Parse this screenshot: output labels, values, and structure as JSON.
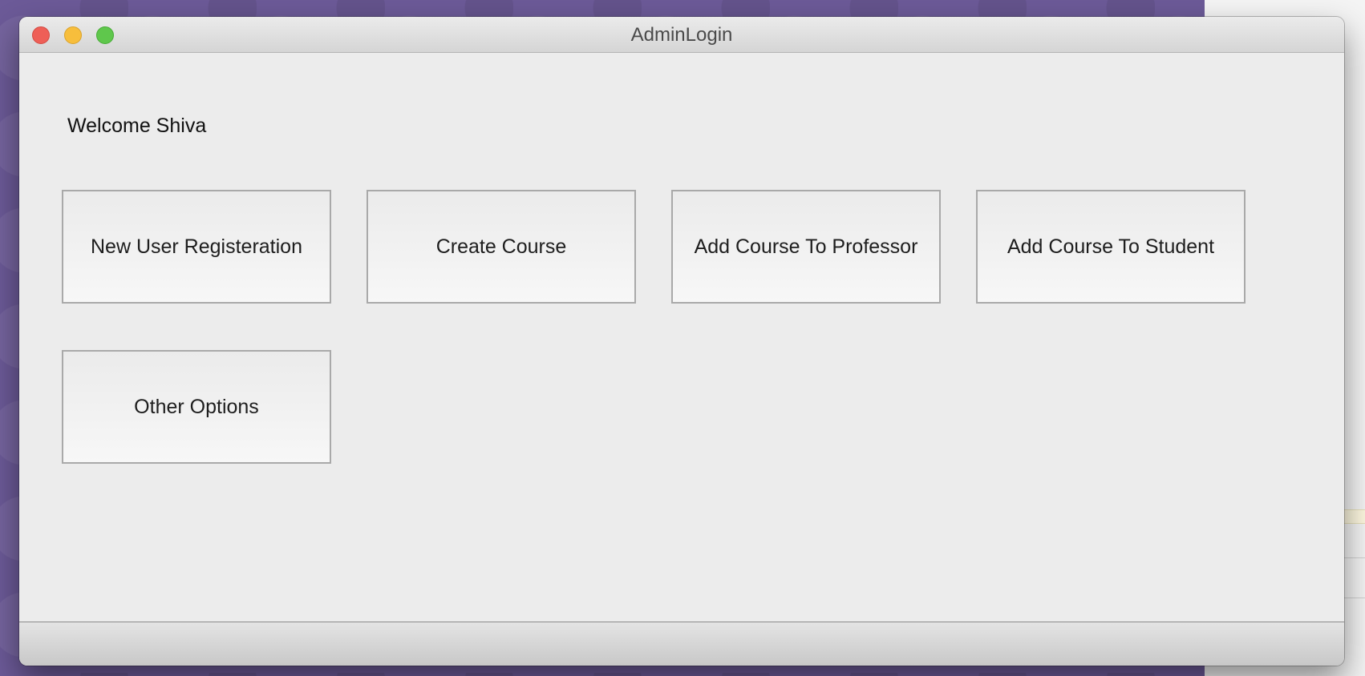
{
  "window": {
    "title": "AdminLogin"
  },
  "content": {
    "welcome_text": "Welcome Shiva",
    "buttons": [
      {
        "label": "New User Registeration"
      },
      {
        "label": "Create Course"
      },
      {
        "label": "Add Course To Professor"
      },
      {
        "label": "Add Course To Student"
      },
      {
        "label": "Other Options"
      }
    ]
  },
  "colors": {
    "close": "#ee5f57",
    "minimize": "#f7be3c",
    "maximize": "#5fc74c",
    "desktop": "#6c5a98"
  }
}
